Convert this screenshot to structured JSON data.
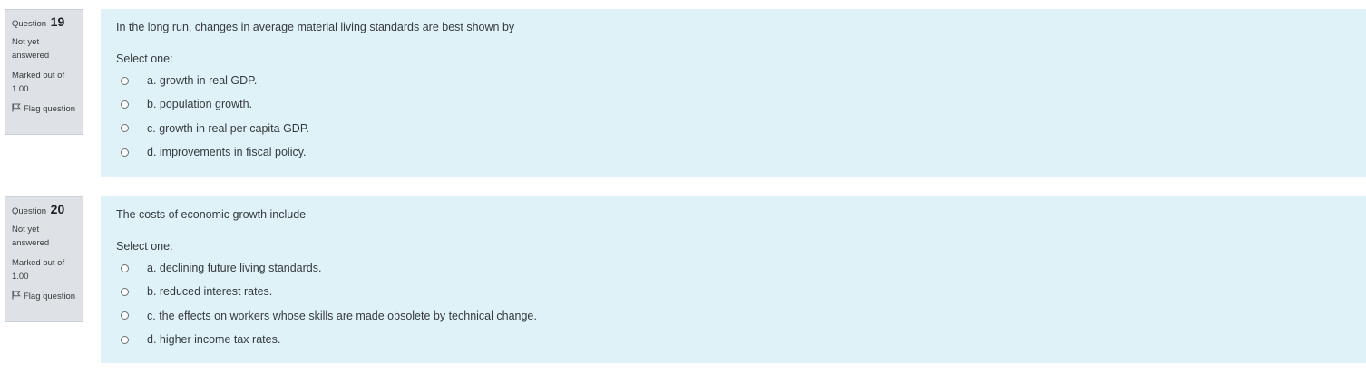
{
  "questions": [
    {
      "label": "Question",
      "number": "19",
      "state": "Not yet answered",
      "grade": "Marked out of 1.00",
      "flag": "Flag question",
      "text": "In the long run, changes in average material living standards are best shown by",
      "prompt": "Select one:",
      "options": [
        "a. growth in real GDP.",
        "b. population growth.",
        "c. growth in real per capita GDP.",
        "d. improvements in fiscal policy."
      ]
    },
    {
      "label": "Question",
      "number": "20",
      "state": "Not yet answered",
      "grade": "Marked out of 1.00",
      "flag": "Flag question",
      "text": "The costs of economic growth include",
      "prompt": "Select one:",
      "options": [
        "a. declining future living standards.",
        "b. reduced interest rates.",
        "c. the effects on workers whose skills are made obsolete by technical change.",
        "d. higher income tax rates."
      ]
    }
  ],
  "colors": {
    "info_bg": "#dee2e6",
    "content_bg": "#def2f8",
    "text": "#373a3c"
  },
  "icons": {
    "flag": "flag-icon",
    "radio": "radio-button"
  }
}
